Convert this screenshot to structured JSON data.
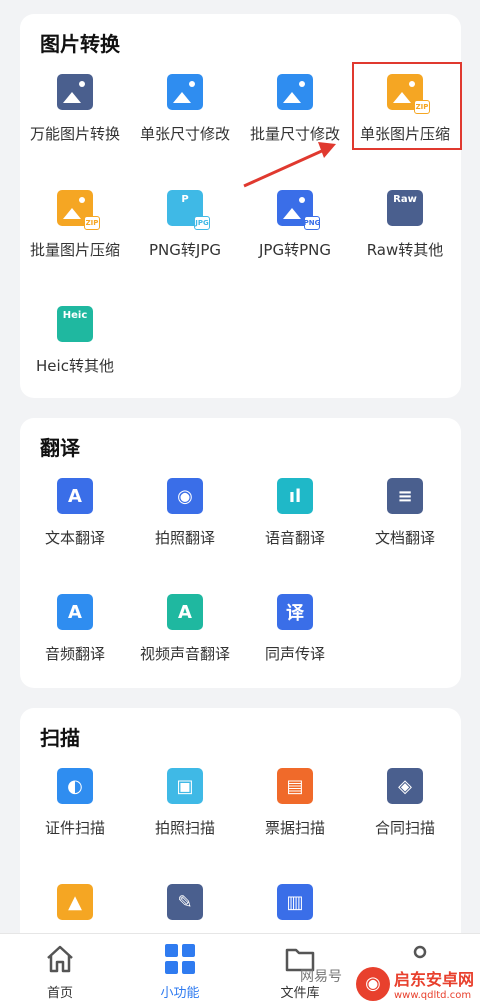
{
  "sections": [
    {
      "title": "图片转换",
      "items": [
        {
          "label": "万能图片转换",
          "icon": "image-convert-icon",
          "color": "#4a5f8e"
        },
        {
          "label": "单张尺寸修改",
          "icon": "image-resize-icon",
          "color": "#2f8df0"
        },
        {
          "label": "批量尺寸修改",
          "icon": "batch-resize-icon",
          "color": "#2f8df0"
        },
        {
          "label": "单张图片压缩",
          "icon": "image-compress-icon",
          "color": "#f5a623",
          "badge": "ZIP"
        },
        {
          "label": "批量图片压缩",
          "icon": "batch-compress-icon",
          "color": "#f5a623",
          "badge": "ZIP"
        },
        {
          "label": "PNG转JPG",
          "icon": "png-to-jpg-icon",
          "color": "#3fb9e6",
          "text": "P",
          "badge": "JPG"
        },
        {
          "label": "JPG转PNG",
          "icon": "jpg-to-png-icon",
          "color": "#3a6ee8",
          "badge": "PNG"
        },
        {
          "label": "Raw转其他",
          "icon": "raw-convert-icon",
          "color": "#4a5f8e",
          "text": "Raw"
        },
        {
          "label": "Heic转其他",
          "icon": "heic-convert-icon",
          "color": "#1fb8a0",
          "text": "Heic"
        }
      ]
    },
    {
      "title": "翻译",
      "items": [
        {
          "label": "文本翻译",
          "icon": "text-translate-icon",
          "color": "#3a6ee8",
          "glyph": "A"
        },
        {
          "label": "拍照翻译",
          "icon": "camera-translate-icon",
          "color": "#3a6ee8",
          "glyph": "◉"
        },
        {
          "label": "语音翻译",
          "icon": "voice-translate-icon",
          "color": "#1fb8c8",
          "glyph": "ıl"
        },
        {
          "label": "文档翻译",
          "icon": "document-translate-icon",
          "color": "#4a5f8e",
          "glyph": "≡"
        },
        {
          "label": "音频翻译",
          "icon": "audio-translate-icon",
          "color": "#2f8df0",
          "glyph": "A"
        },
        {
          "label": "视频声音翻译",
          "icon": "video-translate-icon",
          "color": "#1fb8a0",
          "glyph": "A"
        },
        {
          "label": "同声传译",
          "icon": "simultaneous-interpret-icon",
          "color": "#3a6ee8",
          "glyph": "译"
        }
      ]
    },
    {
      "title": "扫描",
      "items": [
        {
          "label": "证件扫描",
          "icon": "id-scan-icon",
          "color": "#2f8df0",
          "glyph": "◐"
        },
        {
          "label": "拍照扫描",
          "icon": "photo-scan-icon",
          "color": "#3fb9e6",
          "glyph": "▣"
        },
        {
          "label": "票据扫描",
          "icon": "receipt-scan-icon",
          "color": "#f06a2a",
          "glyph": "▤"
        },
        {
          "label": "合同扫描",
          "icon": "contract-scan-icon",
          "color": "#4a5f8e",
          "glyph": "◈"
        },
        {
          "label": "",
          "icon": "image-scan-icon",
          "color": "#f5a623",
          "glyph": "▲"
        },
        {
          "label": "",
          "icon": "text-scan-icon",
          "color": "#4a5f8e",
          "glyph": "✎"
        },
        {
          "label": "",
          "icon": "book-scan-icon",
          "color": "#3a6ee8",
          "glyph": "▥"
        }
      ]
    }
  ],
  "tabs": [
    {
      "label": "首页",
      "icon": "home-icon",
      "active": false
    },
    {
      "label": "小功能",
      "icon": "grid-icon",
      "active": true
    },
    {
      "label": "文件库",
      "icon": "folder-icon",
      "active": false
    },
    {
      "label": "",
      "icon": "profile-icon",
      "active": false
    }
  ],
  "watermark": {
    "title": "启东安卓网",
    "url": "www.qdltd.com",
    "side": "网易号"
  },
  "highlight_color": "#e0392f"
}
